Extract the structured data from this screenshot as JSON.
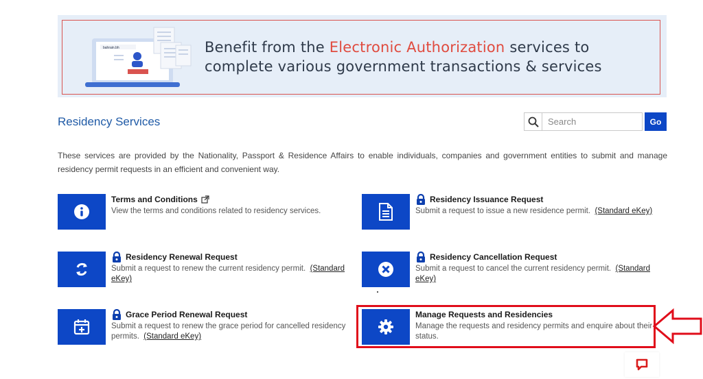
{
  "banner": {
    "line1_pre": "Benefit from the ",
    "line1_accent": "Electronic Authorization",
    "line1_post": " services to",
    "line2": "complete various government transactions & services",
    "mini_brand": "bahrain.bh",
    "accent_color": "#e04b3f"
  },
  "page": {
    "title": "Residency Services",
    "intro": "These services are provided by the Nationality, Passport & Residence Affairs to enable individuals, companies and government entities to submit and manage residency permit requests in an efficient and convenient way."
  },
  "search": {
    "placeholder": "Search",
    "go_label": "Go"
  },
  "services": [
    {
      "title": "Terms and Conditions",
      "desc": "View the terms and conditions related to residency services.",
      "link": "",
      "icon": "info-icon",
      "locked": false,
      "external": true
    },
    {
      "title": "Residency Issuance Request",
      "desc": "Submit a request to issue a new residence permit.",
      "link": "(Standard eKey)",
      "icon": "document-icon",
      "locked": true,
      "external": false
    },
    {
      "title": "Residency Renewal Request",
      "desc": "Submit a request to renew the current residency permit.",
      "link": "(Standard eKey)",
      "icon": "renew-icon",
      "locked": true,
      "external": false
    },
    {
      "title": "Residency Cancellation Request",
      "desc": "Submit a request to cancel the current residency permit.",
      "link": "(Standard eKey)",
      "icon": "cancel-icon",
      "locked": true,
      "external": false
    },
    {
      "title": "Grace Period Renewal Request",
      "desc": "Submit a request to renew the grace period for cancelled residency permits.",
      "link": "(Standard eKey)",
      "icon": "calendar-plus-icon",
      "locked": true,
      "external": false
    },
    {
      "title": "Manage Requests and Residencies",
      "desc": "Manage the requests and residency permits and enquire about their status.",
      "link": "",
      "icon": "gear-icon",
      "locked": false,
      "external": false
    }
  ],
  "colors": {
    "primary": "#0d47c6",
    "title_blue": "#1f5aa6",
    "highlight_red": "#e00d1a"
  }
}
